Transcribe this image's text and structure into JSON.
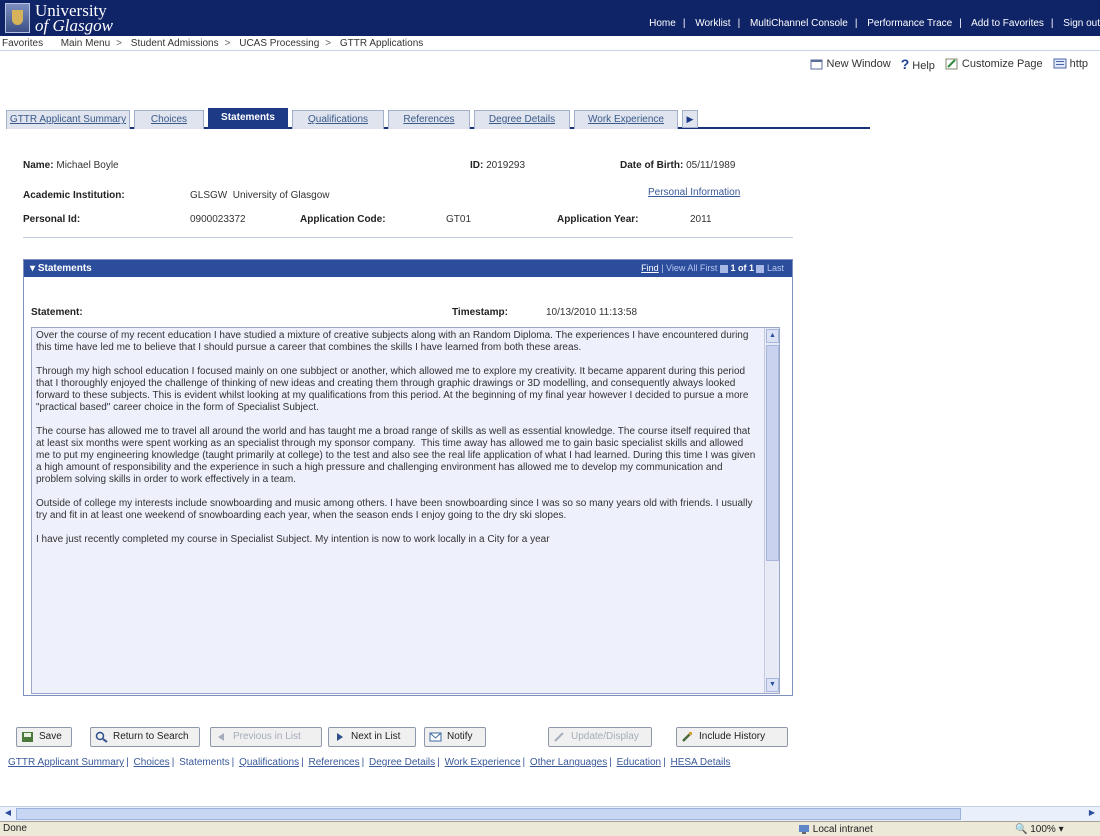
{
  "banner": {
    "logo_line1": "University",
    "logo_line2": "of Glasgow",
    "links": [
      "Home",
      "Worklist",
      "MultiChannel Console",
      "Performance Trace",
      "Add to Favorites",
      "Sign out"
    ]
  },
  "breadcrumb": [
    "Favorites",
    "Main Menu",
    "Student Admissions",
    "UCAS Processing",
    "GTTR Applications"
  ],
  "utility": {
    "new_window": "New Window",
    "help": "Help",
    "customize": "Customize Page",
    "http": "http"
  },
  "tabs": [
    {
      "label": "GTTR Applicant Summary",
      "active": false
    },
    {
      "label": "Choices",
      "active": false
    },
    {
      "label": "Statements",
      "active": true
    },
    {
      "label": "Qualifications",
      "active": false
    },
    {
      "label": "References",
      "active": false
    },
    {
      "label": "Degree Details",
      "active": false
    },
    {
      "label": "Work Experience",
      "active": false
    }
  ],
  "header": {
    "name_label": "Name:",
    "name": "Michael Boyle",
    "id_label": "ID:",
    "id": "2019293",
    "dob_label": "Date of Birth:",
    "dob": "05/11/1989",
    "inst_label": "Academic Institution:",
    "inst_code": "GLSGW",
    "inst_name": "University of Glasgow",
    "personal_info": "Personal Information",
    "pid_label": "Personal Id:",
    "pid": "0900023372",
    "appcode_label": "Application Code:",
    "appcode": "GT01",
    "appyear_label": "Application Year:",
    "appyear": "2011"
  },
  "statements": {
    "title": "Statements",
    "nav_find": "Find",
    "nav_view_all": "View All",
    "nav_first": "First",
    "nav_count": "1 of 1",
    "nav_last": "Last",
    "statement_label": "Statement:",
    "timestamp_label": "Timestamp:",
    "timestamp": "10/13/2010 11:13:58",
    "text": "Over the course of my recent education I have studied a mixture of creative subjects along with an Random Diploma. The experiences I have encountered during this time have led me to believe that I should pursue a career that combines the skills I have learned from both these areas.\n\nThrough my high school education I focused mainly on one subbject or another, which allowed me to explore my creativity. It became apparent during this period that I thoroughly enjoyed the challenge of thinking of new ideas and creating them through graphic drawings or 3D modelling, and consequently always looked forward to these subjects. This is evident whilst looking at my qualifications from this period. At the beginning of my final year however I decided to pursue a more \"practical based\" career choice in the form of Specialist Subject.\n\nThe course has allowed me to travel all around the world and has taught me a broad range of skills as well as essential knowledge. The course itself required that at least six months were spent working as an specialist through my sponsor company.  This time away has allowed me to gain basic specialist skills and allowed me to put my engineering knowledge (taught primarily at college) to the test and also see the real life application of what I had learned. During this time I was given a high amount of responsibility and the experience in such a high pressure and challenging environment has allowed me to develop my communication and problem solving skills in order to work effectively in a team.\n\nOutside of college my interests include snowboarding and music among others. I have been snowboarding since I was so so many years old with friends. I usually try and fit in at least one weekend of snowboarding each year, when the season ends I enjoy going to the dry ski slopes.\n\nI have just recently completed my course in Specialist Subject. My intention is now to work locally in a City for a year"
  },
  "buttons": {
    "save": "Save",
    "return_search": "Return to Search",
    "prev_list": "Previous in List",
    "next_list": "Next in List",
    "notify": "Notify",
    "update_display": "Update/Display",
    "include_history": "Include History"
  },
  "bottom_links": [
    "GTTR Applicant Summary",
    "Choices",
    "Statements",
    "Qualifications",
    "References",
    "Degree Details",
    "Work Experience",
    "Other Languages",
    "Education",
    "HESA Details"
  ],
  "status": {
    "text": "Done",
    "zone": "Local intranet",
    "zoom": "100%"
  }
}
